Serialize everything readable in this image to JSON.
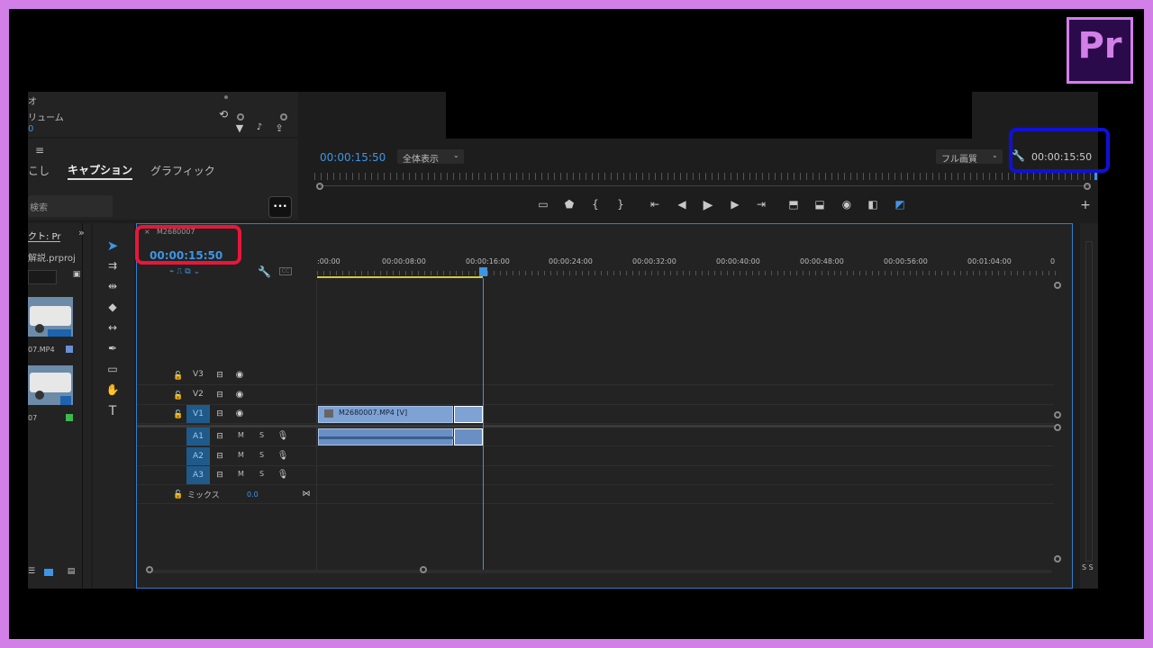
{
  "app": {
    "logo": "Pr"
  },
  "left_panel": {
    "row1": "オ",
    "row2": "リューム",
    "row3": "0",
    "tabs": [
      "こし",
      "キャプション",
      "グラフィック"
    ],
    "search_placeholder": "検索",
    "more": "•••"
  },
  "project": {
    "tab": "クト: Pr",
    "file": "解説.prproj",
    "items": [
      {
        "name": "07.MP4",
        "color": "#6a8fd6"
      },
      {
        "name": "07",
        "color": "#3dba4e"
      }
    ]
  },
  "program_monitor": {
    "timecode": "00:00:15:50",
    "zoom": "全体表示",
    "quality": "フル画質",
    "timecode_right": "00:00:15:50"
  },
  "timeline": {
    "sequence_name": "M2680007",
    "timecode": "00:00:15:50",
    "ruler": [
      ":00:00",
      "00:00:08:00",
      "00:00:16:00",
      "00:00:24:00",
      "00:00:32:00",
      "00:00:40:00",
      "00:00:48:00",
      "00:00:56:00",
      "00:01:04:00",
      "0"
    ],
    "video_tracks": [
      "V3",
      "V2",
      "V1"
    ],
    "audio_tracks": [
      "A1",
      "A2",
      "A3"
    ],
    "mute": "M",
    "solo": "S",
    "mix_label": "ミックス",
    "mix_value": "0.0",
    "video_clip": "M2680007.MP4 [V]"
  }
}
